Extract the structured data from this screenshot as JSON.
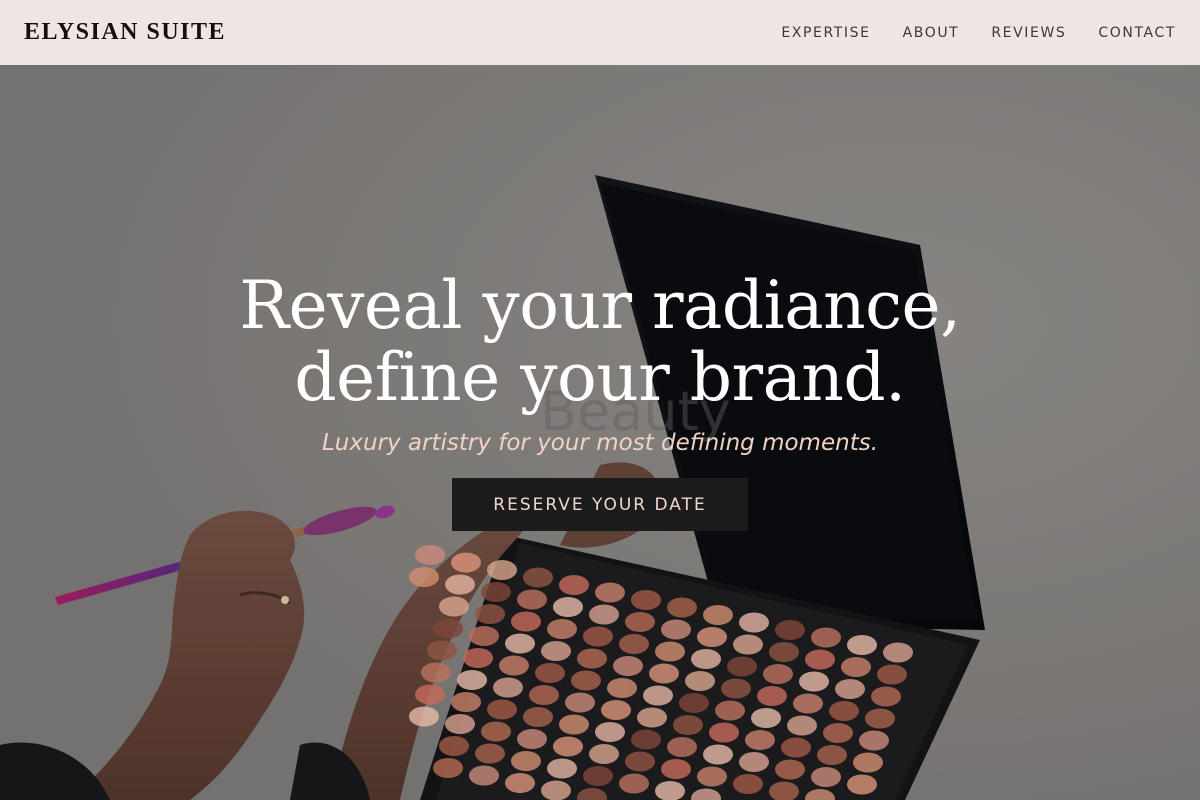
{
  "header": {
    "logo": "ELYSIAN SUITE",
    "nav": [
      {
        "label": "EXPERTISE"
      },
      {
        "label": "ABOUT"
      },
      {
        "label": "REVIEWS"
      },
      {
        "label": "CONTACT"
      }
    ]
  },
  "hero": {
    "title_line1": "Reveal your radiance,",
    "title_line2": "define your brand.",
    "subtitle": "Luxury artistry for your most defining moments.",
    "cta_label": "RESERVE YOUR DATE"
  },
  "colors": {
    "header_bg": "#efe5e2",
    "cta_bg": "#1d1c1c",
    "cta_text": "#f1d7c8",
    "subtitle": "#f1d3c3"
  }
}
